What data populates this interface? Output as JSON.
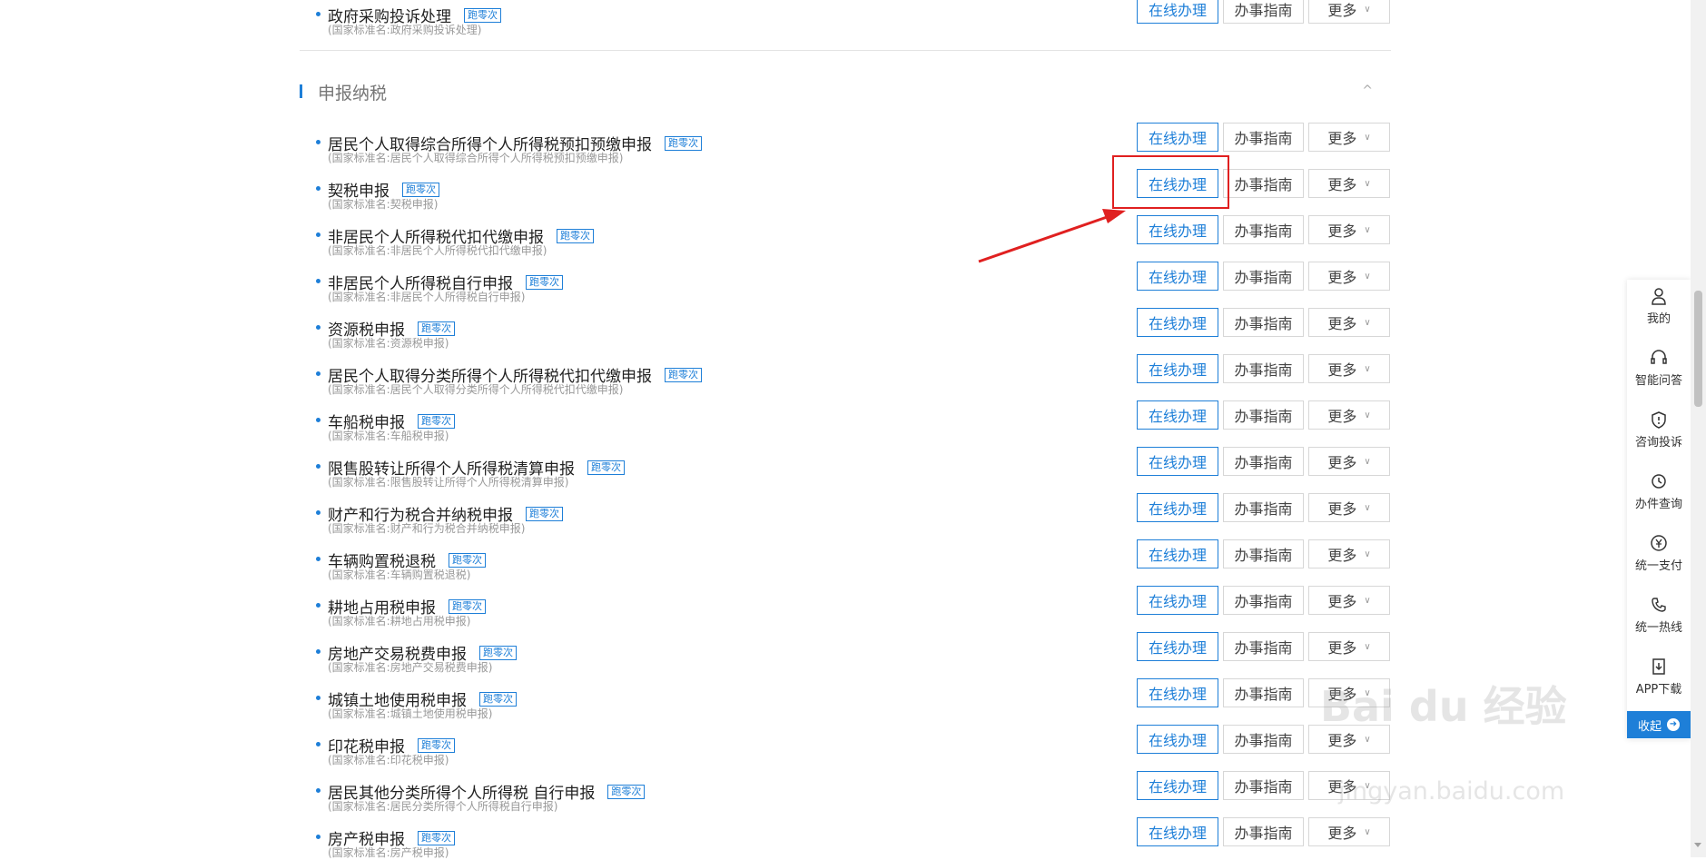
{
  "top_item": {
    "name": "政府采购投诉处理",
    "badge": "跑零次",
    "sub": "(国家标准名:政府采购投诉处理)"
  },
  "section": {
    "title": "申报纳税",
    "caret": "^"
  },
  "buttons": {
    "online": "在线办理",
    "guide": "办事指南",
    "more": "更多"
  },
  "items": [
    {
      "name": "居民个人取得综合所得个人所得税预扣预缴申报",
      "badge": "跑零次",
      "sub": "(国家标准名:居民个人取得综合所得个人所得税预扣预缴申报)"
    },
    {
      "name": "契税申报",
      "badge": "跑零次",
      "sub": "(国家标准名:契税申报)"
    },
    {
      "name": "非居民个人所得税代扣代缴申报",
      "badge": "跑零次",
      "sub": "(国家标准名:非居民个人所得税代扣代缴申报)"
    },
    {
      "name": "非居民个人所得税自行申报",
      "badge": "跑零次",
      "sub": "(国家标准名:非居民个人所得税自行申报)"
    },
    {
      "name": "资源税申报",
      "badge": "跑零次",
      "sub": "(国家标准名:资源税申报)"
    },
    {
      "name": "居民个人取得分类所得个人所得税代扣代缴申报",
      "badge": "跑零次",
      "sub": "(国家标准名:居民个人取得分类所得个人所得税代扣代缴申报)"
    },
    {
      "name": "车船税申报",
      "badge": "跑零次",
      "sub": "(国家标准名:车船税申报)"
    },
    {
      "name": "限售股转让所得个人所得税清算申报",
      "badge": "跑零次",
      "sub": "(国家标准名:限售股转让所得个人所得税清算申报)"
    },
    {
      "name": "财产和行为税合并纳税申报",
      "badge": "跑零次",
      "sub": "(国家标准名:财产和行为税合并纳税申报)"
    },
    {
      "name": "车辆购置税退税",
      "badge": "跑零次",
      "sub": "(国家标准名:车辆购置税退税)"
    },
    {
      "name": "耕地占用税申报",
      "badge": "跑零次",
      "sub": "(国家标准名:耕地占用税申报)"
    },
    {
      "name": "房地产交易税费申报",
      "badge": "跑零次",
      "sub": "(国家标准名:房地产交易税费申报)"
    },
    {
      "name": "城镇土地使用税申报",
      "badge": "跑零次",
      "sub": "(国家标准名:城镇土地使用税申报)"
    },
    {
      "name": "印花税申报",
      "badge": "跑零次",
      "sub": "(国家标准名:印花税申报)"
    },
    {
      "name": "居民其他分类所得个人所得税 自行申报",
      "badge": "跑零次",
      "sub": "(国家标准名:居民分类所得个人所得税自行申报)"
    },
    {
      "name": "房产税申报",
      "badge": "跑零次",
      "sub": "(国家标准名:房产税申报)"
    }
  ],
  "right_panel": {
    "items": [
      {
        "label": "我的",
        "icon": "user-icon"
      },
      {
        "label": "智能问答",
        "icon": "headset-icon"
      },
      {
        "label": "咨询投诉",
        "icon": "shield-icon"
      },
      {
        "label": "办件查询",
        "icon": "history-icon"
      },
      {
        "label": "统一支付",
        "icon": "yuan-icon"
      },
      {
        "label": "统一热线",
        "icon": "phone-icon"
      },
      {
        "label": "APP下载",
        "icon": "download-icon"
      }
    ],
    "collapse": "收起"
  },
  "watermark": {
    "brand": "Bai du 经验",
    "url": "jingyan.baidu.com"
  },
  "colors": {
    "accent": "#1e7fd8",
    "highlight": "#e02020"
  }
}
